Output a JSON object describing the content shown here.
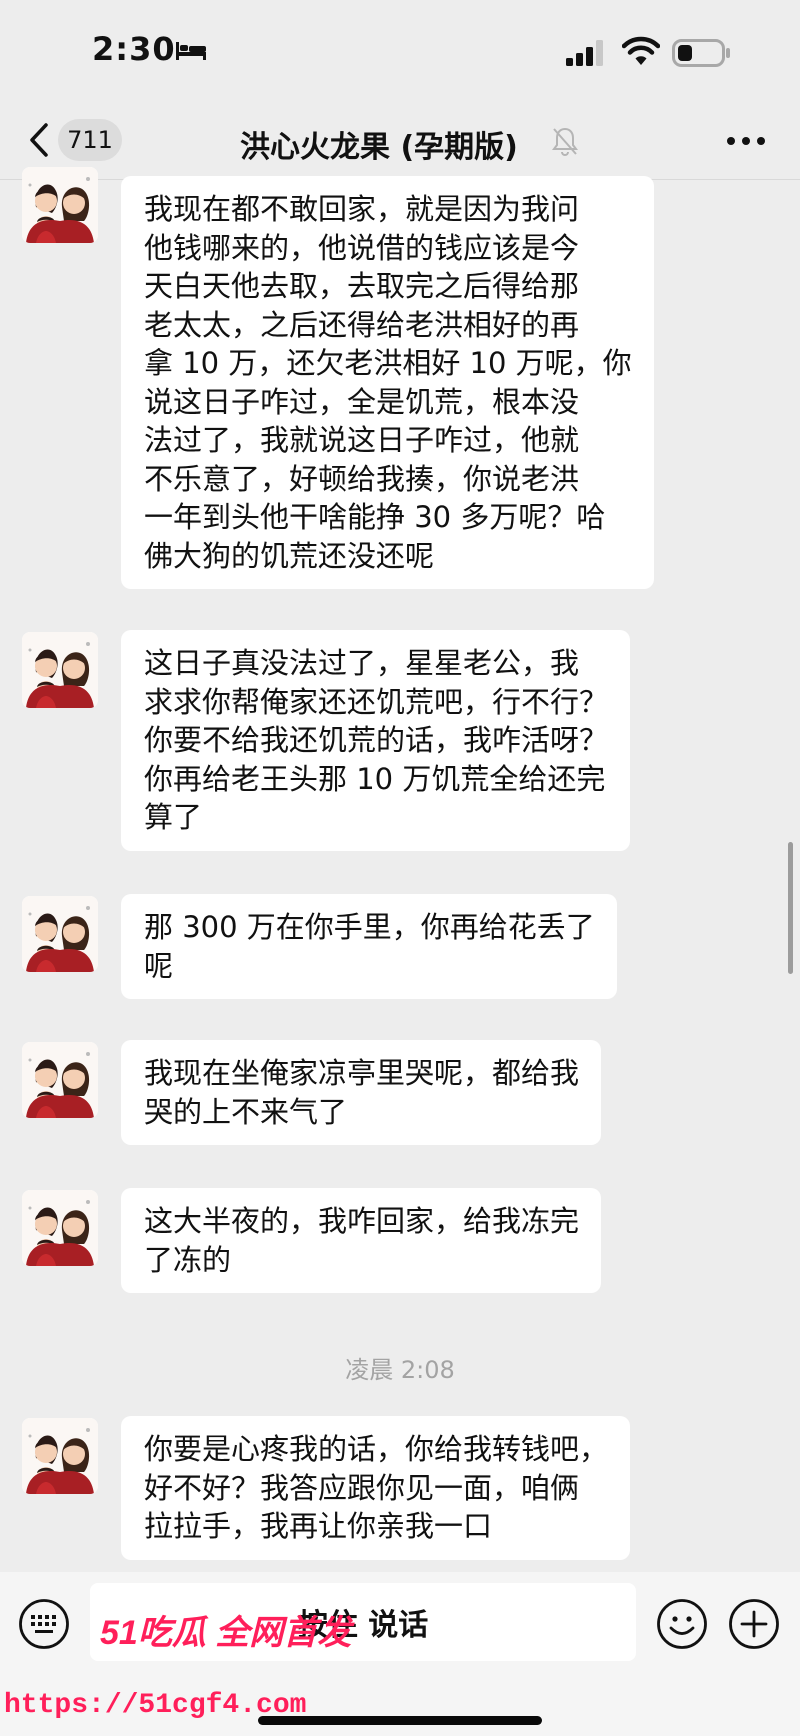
{
  "status_bar": {
    "time": "2:30",
    "icons": [
      "bed-icon",
      "signal-icon",
      "wifi-icon",
      "battery-icon"
    ]
  },
  "nav": {
    "unread_count": "711",
    "title": "洪心火龙果 (孕期版)",
    "icons": [
      "back-icon",
      "mute-icon",
      "more-icon"
    ]
  },
  "messages": [
    {
      "lines": [
        "我现在都不敢回家，就是因为我问",
        "他钱哪来的，他说借的钱应该是今",
        "天白天他去取，去取完之后得给那",
        "老太太，之后还得给老洪相好的再",
        "拿 10 万，还欠老洪相好 10 万呢，你",
        "说这日子咋过，全是饥荒，根本没",
        "法过了，我就说这日子咋过，他就",
        "不乐意了，好顿给我揍，你说老洪",
        "一年到头他干啥能挣 30 多万呢？哈",
        "佛大狗的饥荒还没还呢"
      ]
    },
    {
      "lines": [
        "这日子真没法过了，星星老公，我",
        "求求你帮俺家还还饥荒吧，行不行？",
        "你要不给我还饥荒的话，我咋活呀？",
        "你再给老王头那 10 万饥荒全给还完",
        "算了"
      ]
    },
    {
      "lines": [
        "那 300 万在你手里，你再给花丢了",
        "呢"
      ]
    },
    {
      "lines": [
        "我现在坐俺家凉亭里哭呢，都给我",
        "哭的上不来气了"
      ]
    },
    {
      "lines": [
        "这大半夜的，我咋回家，给我冻完",
        "了冻的"
      ]
    },
    {
      "lines": [
        "你要是心疼我的话，你给我转钱吧，",
        "好不好？我答应跟你见一面，咱俩",
        "拉拉手，我再让你亲我一口"
      ]
    }
  ],
  "timestamp": "凌晨 2:08",
  "input_bar": {
    "hold_to_talk": "按住 说话",
    "icons": [
      "keyboard-icon",
      "emoji-icon",
      "plus-icon"
    ]
  },
  "watermark": {
    "brand": "51吃瓜 全网首发",
    "url": "https://51cgf4.com"
  },
  "colors": {
    "background": "#ededed",
    "bubble": "#ffffff",
    "watermark": "#ff1f5a"
  }
}
